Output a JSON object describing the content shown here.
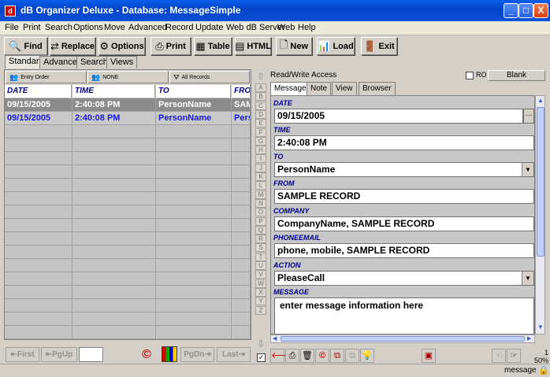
{
  "window": {
    "title": "dB Organizer Deluxe - Database: MessageSimple",
    "min": "_",
    "max": "□",
    "close": "X"
  },
  "menu": [
    "File",
    "Print",
    "Search",
    "Options",
    "Move",
    "Advanced",
    "Record",
    "Update",
    "Web dB Server",
    "Web",
    "Help"
  ],
  "toolbar": [
    "Find",
    "Replace",
    "Options",
    "Print",
    "Table",
    "HTML",
    "New",
    "Load",
    "Exit"
  ],
  "left_tabs": [
    "Standard",
    "Advanced",
    "Search",
    "Views"
  ],
  "sort": {
    "order": "Entry Order",
    "filter": "NONE",
    "records": "All Records"
  },
  "grid": {
    "headers": [
      "DATE",
      "TIME",
      "TO",
      "FROM"
    ],
    "rows": [
      [
        "09/15/2005",
        "2:40:08 PM",
        "PersonName",
        "SAMPLE RECORD"
      ],
      [
        "09/15/2005",
        "2:40:08 PM",
        "PersonName",
        "Person"
      ]
    ]
  },
  "nav": {
    "first": "First",
    "pgup": "PgUp",
    "pgdn": "PgDn",
    "last": "Last"
  },
  "alphabet": [
    "A",
    "B",
    "C",
    "D",
    "E",
    "F",
    "G",
    "H",
    "I",
    "J",
    "K",
    "L",
    "M",
    "N",
    "O",
    "P",
    "Q",
    "R",
    "S",
    "T",
    "U",
    "V",
    "W",
    "X",
    "Y",
    "Z"
  ],
  "access": "Read/Write Access",
  "ro_label": "RO",
  "blank_label": "Blank",
  "right_tabs": [
    "Message",
    "Note",
    "View",
    "Browser"
  ],
  "fields": {
    "date": {
      "label": "DATE",
      "value": "09/15/2005"
    },
    "time": {
      "label": "TIME",
      "value": "2:40:08 PM"
    },
    "to": {
      "label": "TO",
      "value": "PersonName"
    },
    "from": {
      "label": "FROM",
      "value": "SAMPLE RECORD"
    },
    "company": {
      "label": "COMPANY",
      "value": "CompanyName, SAMPLE RECORD"
    },
    "phone": {
      "label": "PHONEEMAIL",
      "value": "phone, mobile, SAMPLE RECORD"
    },
    "action": {
      "label": "ACTION",
      "value": "PleaseCall"
    },
    "message": {
      "label": "MESSAGE",
      "value": "enter message information here"
    }
  },
  "zoom": {
    "page": "1",
    "percent": "50%"
  },
  "status": "message"
}
